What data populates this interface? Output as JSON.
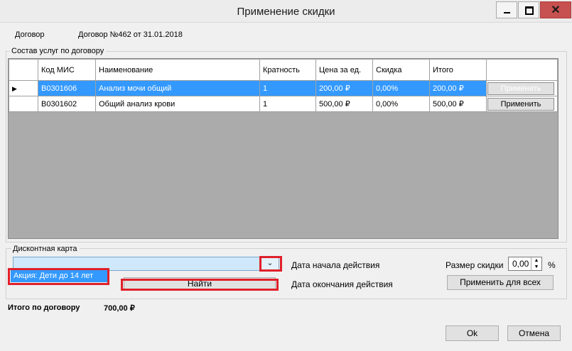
{
  "window": {
    "title": "Применение скидки"
  },
  "contract": {
    "label": "Договор",
    "value": "Договор №462 от 31.01.2018"
  },
  "services": {
    "group_label": "Состав услуг по договору",
    "columns": [
      "Код МИС",
      "Наименование",
      "Кратность",
      "Цена за ед.",
      "Скидка",
      "Итого"
    ],
    "rows": [
      {
        "code": "B0301606",
        "name": "Анализ мочи общий",
        "mult": "1",
        "price": "200,00 ₽",
        "discount": "0,00%",
        "total": "200,00 ₽",
        "button": "Применить",
        "selected": true
      },
      {
        "code": "B0301602",
        "name": "Общий  анализ крови",
        "mult": "1",
        "price": "500,00 ₽",
        "discount": "0,00%",
        "total": "500,00 ₽",
        "button": "Применить",
        "selected": false
      }
    ]
  },
  "discount_card": {
    "group_label": "Дисконтная карта",
    "combo_value": "",
    "dropdown_item": "Акция: Дети до 14 лет",
    "find_button": "Найти",
    "start_date_label": "Дата начала действия",
    "end_date_label": "Дата окончания действия",
    "size_label": "Размер скидки",
    "size_value": "0,00",
    "percent": "%",
    "apply_all_button": "Применить для всех"
  },
  "total": {
    "label": "Итого по договору",
    "value": "700,00 ₽"
  },
  "footer": {
    "ok": "Ok",
    "cancel": "Отмена"
  },
  "colors": {
    "selection": "#3399ff",
    "annotation": "#e0202a",
    "grid_bg": "#ababab"
  }
}
